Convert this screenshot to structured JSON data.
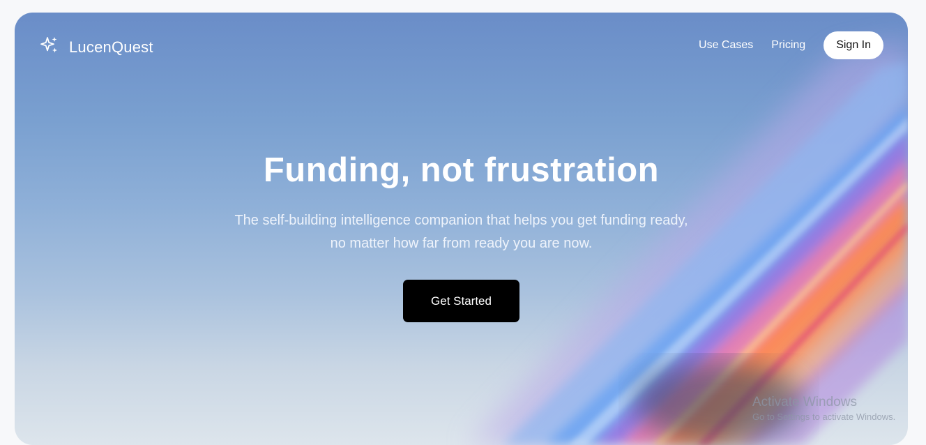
{
  "brand": {
    "name": "LucenQuest",
    "icon": "sparkles-icon"
  },
  "nav": {
    "links": [
      "Use Cases",
      "Pricing"
    ],
    "sign_in_label": "Sign In"
  },
  "hero": {
    "headline": "Funding, not frustration",
    "subtitle": "The self-building intelligence companion that helps you get funding ready, no matter how far from ready you are now.",
    "cta_label": "Get Started"
  },
  "watermark": {
    "title": "Activate Windows",
    "subtitle": "Go to Settings to activate Windows."
  },
  "colors": {
    "background": "#f7f8fa",
    "hero_top": "#6a8dc8",
    "hero_bottom": "#dde5ec",
    "cta_bg": "#000000",
    "signin_bg": "#ffffff"
  }
}
